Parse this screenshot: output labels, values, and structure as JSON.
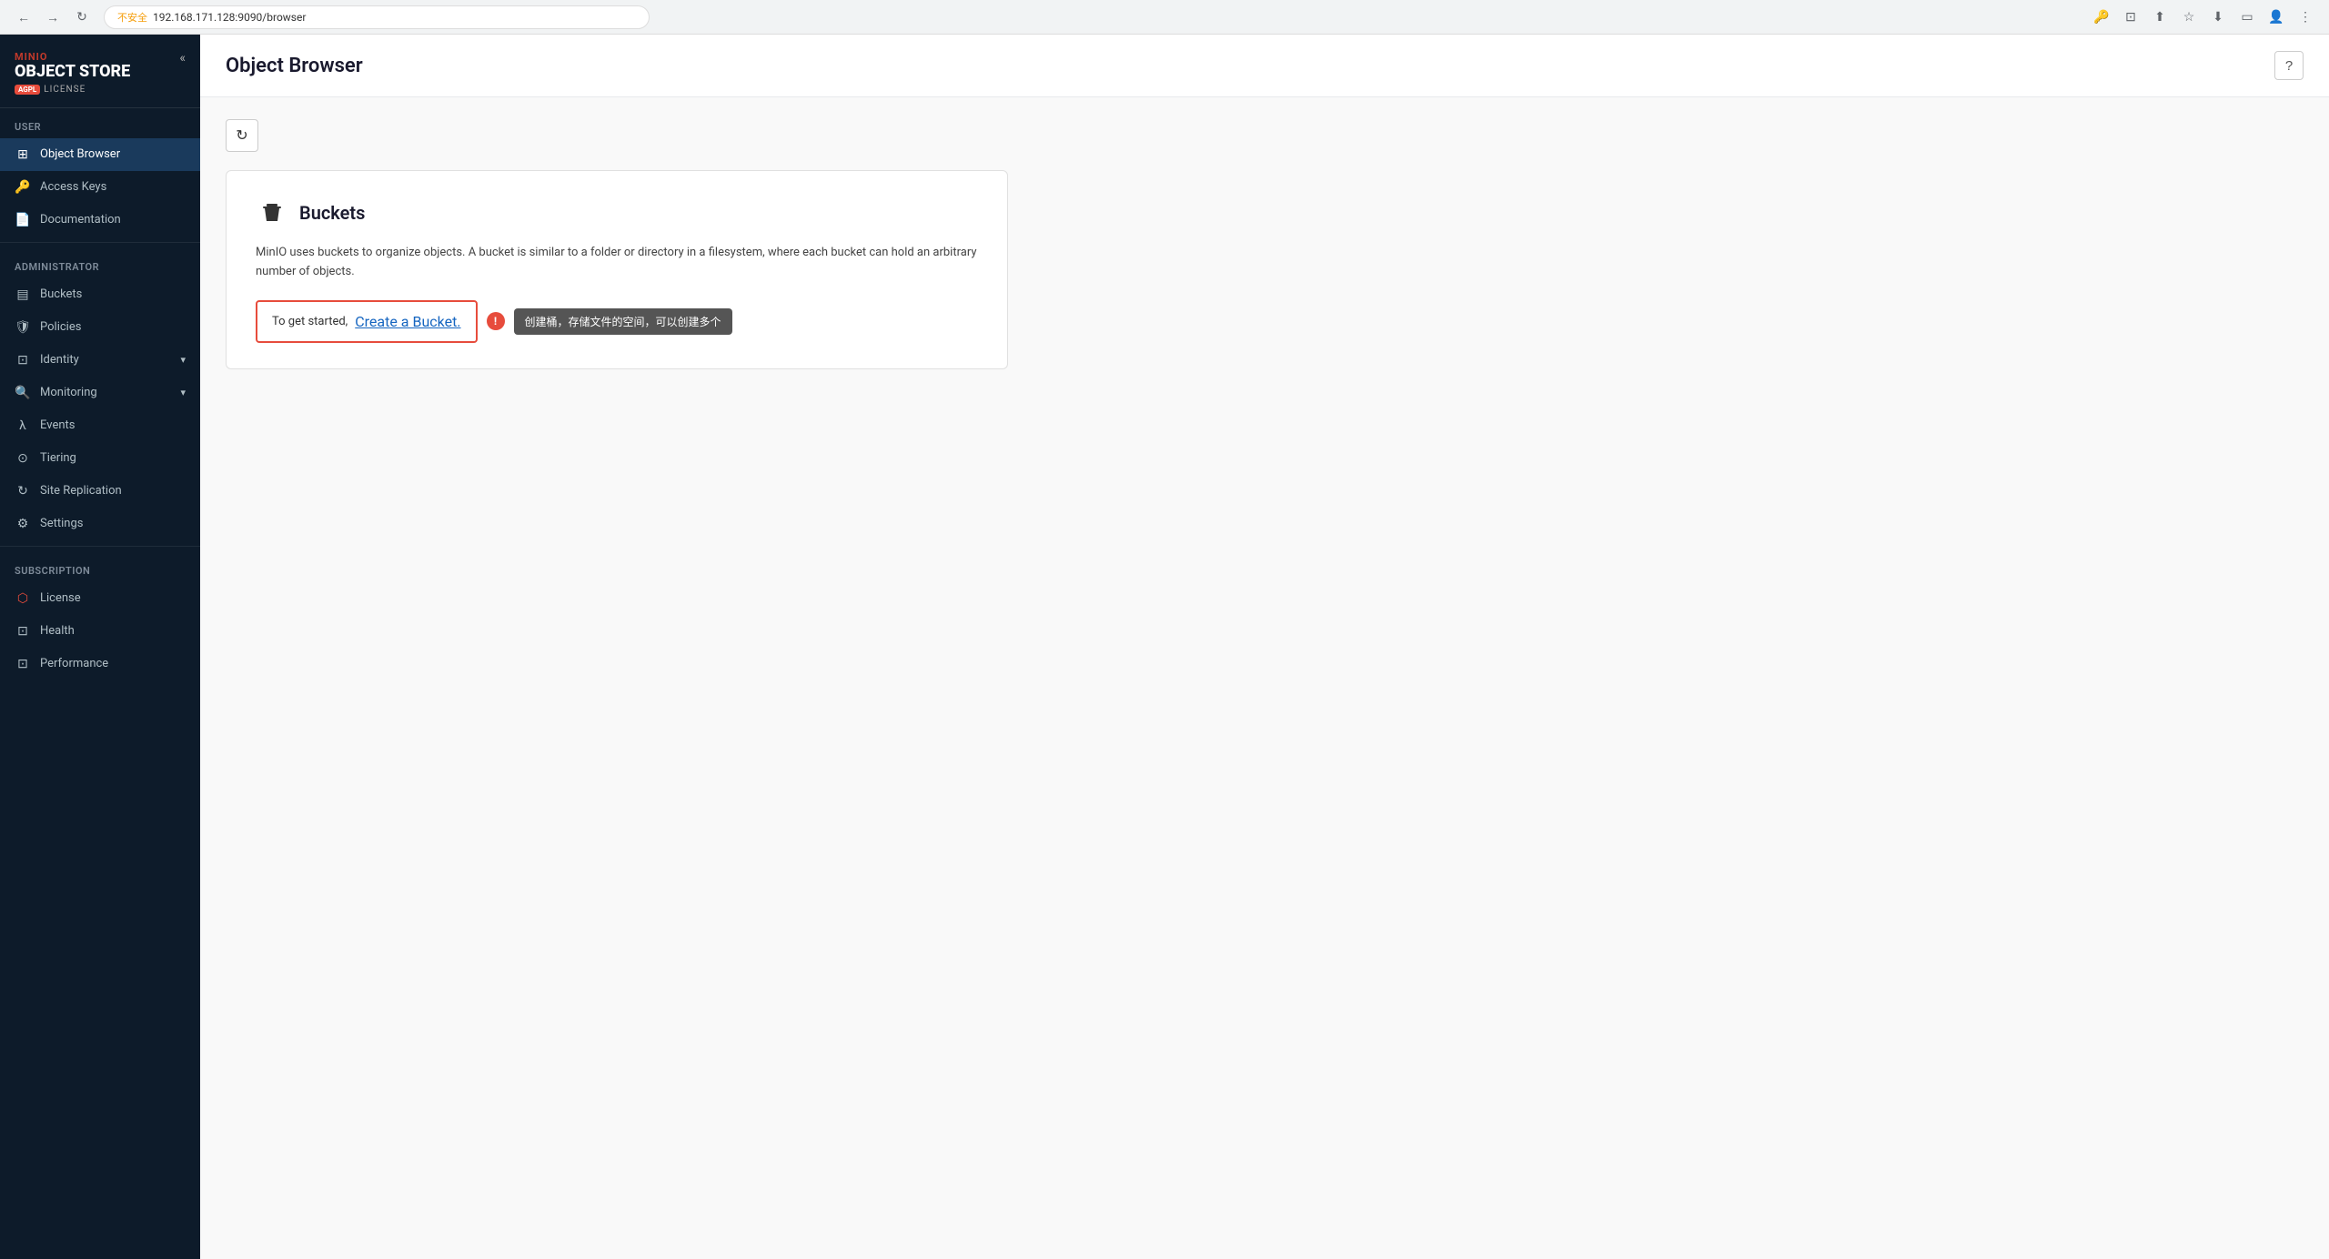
{
  "browser": {
    "back_btn": "←",
    "forward_btn": "→",
    "reload_btn": "↻",
    "warning_text": "不安全",
    "url": "192.168.171.128:9090/browser",
    "key_icon": "🔑",
    "cast_icon": "⊡",
    "share_icon": "⬆",
    "bookmark_icon": "☆",
    "download_icon": "⬇",
    "sidebar_icon": "▭",
    "profile_icon": "👤",
    "menu_icon": "⋮"
  },
  "sidebar": {
    "logo": {
      "minio": "MINIO",
      "object_store": "OBJECT STORE",
      "agpl_badge": "AGPL",
      "license": "LICENSE"
    },
    "collapse_icon": "«",
    "user_section": "User",
    "user_items": [
      {
        "id": "object-browser",
        "label": "Object Browser",
        "icon": "⊞",
        "active": true
      },
      {
        "id": "access-keys",
        "label": "Access Keys",
        "icon": "🔑",
        "active": false
      },
      {
        "id": "documentation",
        "label": "Documentation",
        "icon": "📄",
        "active": false
      }
    ],
    "admin_section": "Administrator",
    "admin_items": [
      {
        "id": "buckets",
        "label": "Buckets",
        "icon": "▤",
        "active": false
      },
      {
        "id": "policies",
        "label": "Policies",
        "icon": "🛡",
        "active": false
      },
      {
        "id": "identity",
        "label": "Identity",
        "icon": "⊡",
        "active": false,
        "has_chevron": true
      },
      {
        "id": "monitoring",
        "label": "Monitoring",
        "icon": "🔍",
        "active": false,
        "has_chevron": true
      },
      {
        "id": "events",
        "label": "Events",
        "icon": "λ",
        "active": false
      },
      {
        "id": "tiering",
        "label": "Tiering",
        "icon": "⊙",
        "active": false
      },
      {
        "id": "site-replication",
        "label": "Site Replication",
        "icon": "↻",
        "active": false
      },
      {
        "id": "settings",
        "label": "Settings",
        "icon": "⚙",
        "active": false
      }
    ],
    "subscription_section": "Subscription",
    "subscription_items": [
      {
        "id": "license",
        "label": "License",
        "icon": "🔴",
        "active": false
      },
      {
        "id": "health",
        "label": "Health",
        "icon": "⊡",
        "active": false
      },
      {
        "id": "performance",
        "label": "Performance",
        "icon": "⊡",
        "active": false
      }
    ]
  },
  "header": {
    "title": "Object Browser",
    "help_icon": "?"
  },
  "main": {
    "refresh_icon": "↻",
    "buckets_card": {
      "title": "Buckets",
      "description": "MinIO uses buckets to organize objects. A bucket is similar to a folder or directory in a filesystem, where each bucket can hold an arbitrary number of objects.",
      "get_started_text": "To get started,",
      "create_link_text": "Create a Bucket.",
      "tooltip_icon": "!",
      "tooltip_text": "创建桶，存储文件的空间，可以创建多个"
    }
  }
}
